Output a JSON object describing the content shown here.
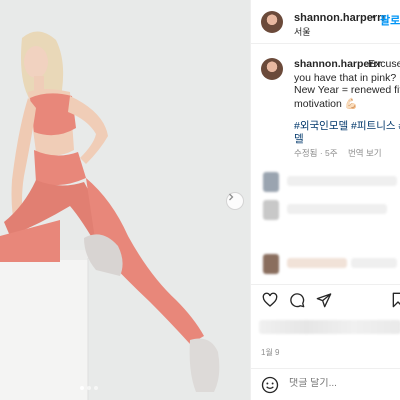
{
  "header": {
    "username": "shannon.harperrr",
    "separator": "•",
    "follow_label": "팔로",
    "location": "서울"
  },
  "caption": {
    "username": "shannon.harperrr",
    "line1": "Excuse",
    "line2": "you have that in pink? 😌",
    "line3": "New Year = renewed fitne",
    "line4": "motivation 💪🏻",
    "hashtags_line1": "#외국인모델 #피트니스 #",
    "hashtags_line2": "델"
  },
  "meta": {
    "edited": "수정됨 · 5주",
    "see_translation": "번역 보기"
  },
  "actions": {
    "like_icon": "heart-icon",
    "comment_icon": "comment-icon",
    "share_icon": "share-icon",
    "save_icon": "bookmark-icon"
  },
  "date": "1월 9",
  "comment_box": {
    "placeholder": "댓글 달기..."
  },
  "carousel": {
    "next_icon": "chevron-right-icon",
    "slides": 3,
    "active_slide": 1
  },
  "colors": {
    "outfit": "#e8877a",
    "link": "#0095f6",
    "hashtag": "#00376b",
    "background": "#e7e9e8"
  }
}
